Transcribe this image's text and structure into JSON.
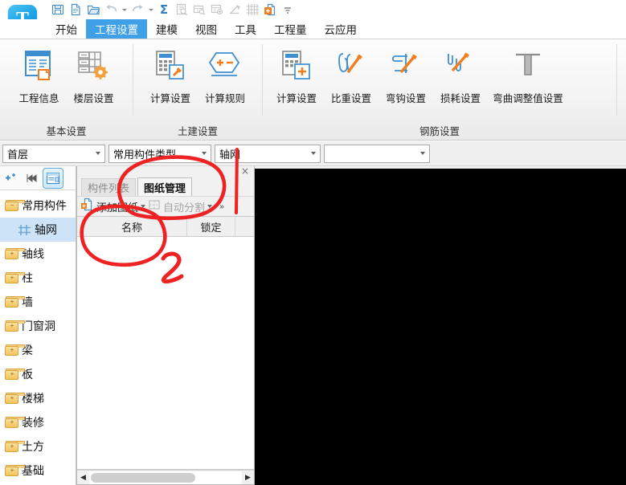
{
  "app": {
    "logo_icon": "app-logo-t",
    "logo_letter": "T"
  },
  "quick_access": {
    "items": [
      {
        "name": "save-icon",
        "label": "保存",
        "enabled": true,
        "caret": false
      },
      {
        "name": "new-file-icon",
        "label": "新建",
        "enabled": true,
        "caret": false
      },
      {
        "name": "open-folder-icon",
        "label": "打开",
        "enabled": true,
        "caret": false
      },
      {
        "name": "undo-icon",
        "label": "撤销",
        "enabled": false,
        "caret": true
      },
      {
        "name": "redo-icon",
        "label": "恢复",
        "enabled": false,
        "caret": true
      },
      {
        "name": "sum-sigma-icon",
        "label": "汇总计算",
        "enabled": true,
        "caret": false
      },
      {
        "name": "report-preview-icon",
        "label": "报表预览",
        "enabled": false,
        "caret": false
      },
      {
        "name": "report-query-icon",
        "label": "查看报表",
        "enabled": false,
        "caret": false
      },
      {
        "name": "report-add-icon",
        "label": "云报表",
        "enabled": false,
        "caret": false
      },
      {
        "name": "measure-pencil-icon",
        "label": "测量",
        "enabled": false,
        "caret": false
      },
      {
        "name": "grid-axis-icon",
        "label": "轴网",
        "enabled": false,
        "caret": false
      },
      {
        "name": "add-document-icon",
        "label": "添加",
        "enabled": true,
        "caret": false
      },
      {
        "name": "customize-qat-icon",
        "label": "自定义",
        "enabled": true,
        "caret": false
      }
    ]
  },
  "ribbon": {
    "tabs": [
      {
        "label": "开始",
        "active": false
      },
      {
        "label": "工程设置",
        "active": true
      },
      {
        "label": "建模",
        "active": false
      },
      {
        "label": "视图",
        "active": false
      },
      {
        "label": "工具",
        "active": false
      },
      {
        "label": "工程量",
        "active": false
      },
      {
        "label": "云应用",
        "active": false
      }
    ],
    "groups": [
      {
        "title": "基本设置",
        "items": [
          {
            "label": "工程信息",
            "icon": "project-info-icon",
            "wide": false
          },
          {
            "label": "楼层设置",
            "icon": "floor-settings-icon",
            "wide": false
          }
        ]
      },
      {
        "title": "土建设置",
        "items": [
          {
            "label": "计算设置",
            "icon": "calc-settings-icon",
            "wide": false
          },
          {
            "label": "计算规则",
            "icon": "calc-rules-icon",
            "wide": false
          }
        ]
      },
      {
        "title": "钢筋设置",
        "items": [
          {
            "label": "计算设置",
            "icon": "rebar-calc-settings-icon",
            "wide": false
          },
          {
            "label": "比重设置",
            "icon": "weight-settings-icon",
            "wide": false
          },
          {
            "label": "弯钩设置",
            "icon": "hook-settings-icon",
            "wide": false
          },
          {
            "label": "损耗设置",
            "icon": "loss-settings-icon",
            "wide": false
          },
          {
            "label": "弯曲调整值设置",
            "icon": "bend-adjust-settings-icon",
            "wide": true
          }
        ]
      }
    ]
  },
  "selector_bar": {
    "floor": {
      "value": "首层",
      "placeholder": ""
    },
    "category": {
      "value": "常用构件类型",
      "placeholder": ""
    },
    "component": {
      "value": "轴网",
      "placeholder": ""
    },
    "extra": {
      "value": "",
      "placeholder": ""
    }
  },
  "sidebar": {
    "toolbar": [
      {
        "name": "new-component-icon",
        "label": "新建构件",
        "active": false
      },
      {
        "name": "expand-all-icon",
        "label": "展开",
        "active": false
      },
      {
        "name": "toggle-panel-icon",
        "label": "属性列表",
        "active": true
      }
    ],
    "tree": [
      {
        "label": "常用构件",
        "icon": "folder-open-icon",
        "level": 0,
        "selected": false
      },
      {
        "label": "轴网",
        "icon": "grid-axis-icon",
        "level": 1,
        "selected": true
      },
      {
        "label": "轴线",
        "icon": "folder-plus-icon",
        "level": 0,
        "selected": false
      },
      {
        "label": "柱",
        "icon": "folder-plus-icon",
        "level": 0,
        "selected": false
      },
      {
        "label": "墙",
        "icon": "folder-plus-icon",
        "level": 0,
        "selected": false
      },
      {
        "label": "门窗洞",
        "icon": "folder-plus-icon",
        "level": 0,
        "selected": false
      },
      {
        "label": "梁",
        "icon": "folder-plus-icon",
        "level": 0,
        "selected": false
      },
      {
        "label": "板",
        "icon": "folder-plus-icon",
        "level": 0,
        "selected": false
      },
      {
        "label": "楼梯",
        "icon": "folder-plus-icon",
        "level": 0,
        "selected": false
      },
      {
        "label": "装修",
        "icon": "folder-plus-icon",
        "level": 0,
        "selected": false
      },
      {
        "label": "土方",
        "icon": "folder-plus-icon",
        "level": 0,
        "selected": false
      },
      {
        "label": "基础",
        "icon": "folder-plus-icon",
        "level": 0,
        "selected": false
      }
    ]
  },
  "panel": {
    "close_label": "×",
    "tabs": [
      {
        "label": "构件列表",
        "active": false
      },
      {
        "label": "图纸管理",
        "active": true
      }
    ],
    "toolbar": [
      {
        "label": "添加图纸",
        "icon": "add-drawing-icon",
        "enabled": true,
        "caret": true
      },
      {
        "label": "自动分割",
        "icon": "auto-split-icon",
        "enabled": false,
        "caret": true
      }
    ],
    "more_label": "»",
    "grid": {
      "columns": [
        "名称",
        "锁定"
      ],
      "rows": []
    },
    "hscroll": {
      "left_arrow": "◀",
      "right_arrow": "▶"
    }
  },
  "canvas": {
    "background": "#000000"
  },
  "annotations": {
    "color": "#ee2222",
    "marks": [
      {
        "name": "ellipse-around-drawing-tab",
        "type": "ellipse"
      },
      {
        "name": "ellipse-around-add-drawing",
        "type": "ellipse"
      },
      {
        "name": "vertical-line-pointer",
        "type": "line"
      },
      {
        "name": "handwritten-digit-2",
        "type": "text",
        "text": "2"
      }
    ]
  }
}
